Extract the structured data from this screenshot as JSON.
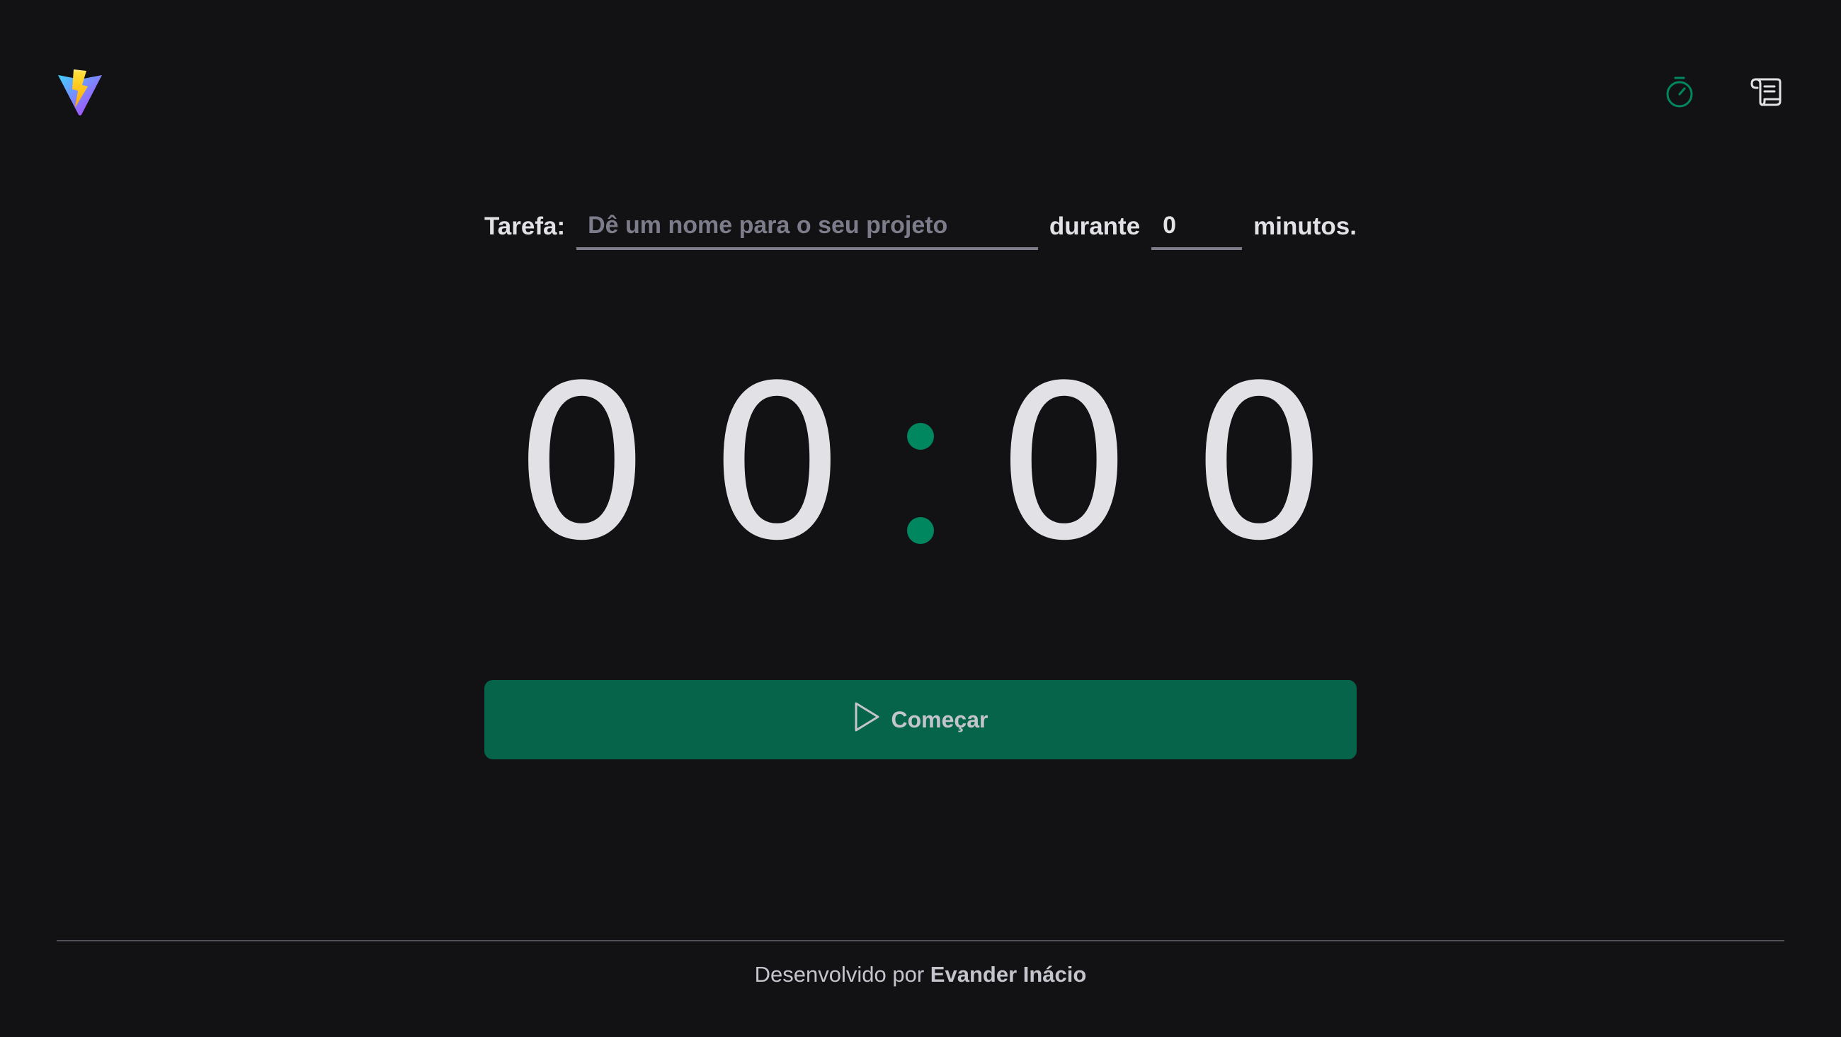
{
  "header": {
    "logo": {
      "icon": "vite-logo-icon"
    },
    "nav": [
      {
        "icon": "timer-icon",
        "active": true,
        "color": "#00875f"
      },
      {
        "icon": "scroll-icon",
        "active": false,
        "color": "#e1e1e6"
      }
    ]
  },
  "form": {
    "task_label": "Tarefa:",
    "task_placeholder": "Dê um nome para o seu projeto",
    "task_value": "",
    "during_label": "durante",
    "minutes_value": "0",
    "minutes_label": "minutos."
  },
  "countdown": {
    "minutes_tens": "0",
    "minutes_ones": "0",
    "seconds_tens": "0",
    "seconds_ones": "0",
    "separator_color": "#00875f"
  },
  "start_button": {
    "icon": "play-icon",
    "label": "Começar",
    "color": "#06644a"
  },
  "footer": {
    "prefix": "Desenvolvido por ",
    "author": "Evander Inácio"
  }
}
